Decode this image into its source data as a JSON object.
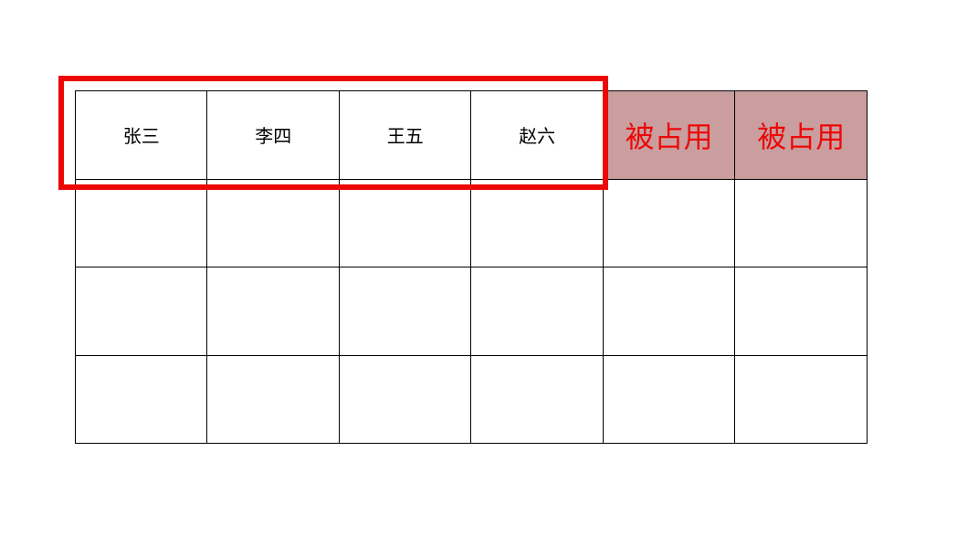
{
  "grid": {
    "rows": 4,
    "cols": 6,
    "row1": {
      "cell1": "张三",
      "cell2": "李四",
      "cell3": "王五",
      "cell4": "赵六",
      "cell5": "被占用",
      "cell6": "被占用"
    }
  },
  "colors": {
    "highlight_border": "#ed0808",
    "occupied_bg": "#ca9e9e",
    "occupied_text": "#ed0808"
  }
}
